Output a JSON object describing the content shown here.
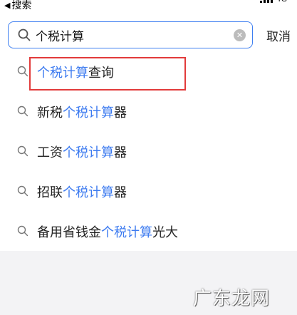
{
  "status_bar": {
    "back_label": "搜索",
    "network": "4G"
  },
  "search": {
    "query": "个税计算",
    "cancel_label": "取消"
  },
  "suggestions": [
    {
      "parts": [
        {
          "text": "个税计算",
          "hl": true
        },
        {
          "text": "查询",
          "hl": false
        }
      ]
    },
    {
      "parts": [
        {
          "text": "新税",
          "hl": false
        },
        {
          "text": "个税计算",
          "hl": true
        },
        {
          "text": "器",
          "hl": false
        }
      ]
    },
    {
      "parts": [
        {
          "text": "工资",
          "hl": false
        },
        {
          "text": "个税计算",
          "hl": true
        },
        {
          "text": "器",
          "hl": false
        }
      ]
    },
    {
      "parts": [
        {
          "text": "招联",
          "hl": false
        },
        {
          "text": "个税计算",
          "hl": true
        },
        {
          "text": "器",
          "hl": false
        }
      ]
    },
    {
      "parts": [
        {
          "text": "备用省钱金",
          "hl": false
        },
        {
          "text": "个税计算",
          "hl": true
        },
        {
          "text": "光大",
          "hl": false
        }
      ]
    }
  ],
  "watermark": "广东龙网",
  "colors": {
    "accent": "#3e7ff1",
    "highlight_text": "#3d7bf0",
    "annotation_box": "#e23b3b"
  }
}
